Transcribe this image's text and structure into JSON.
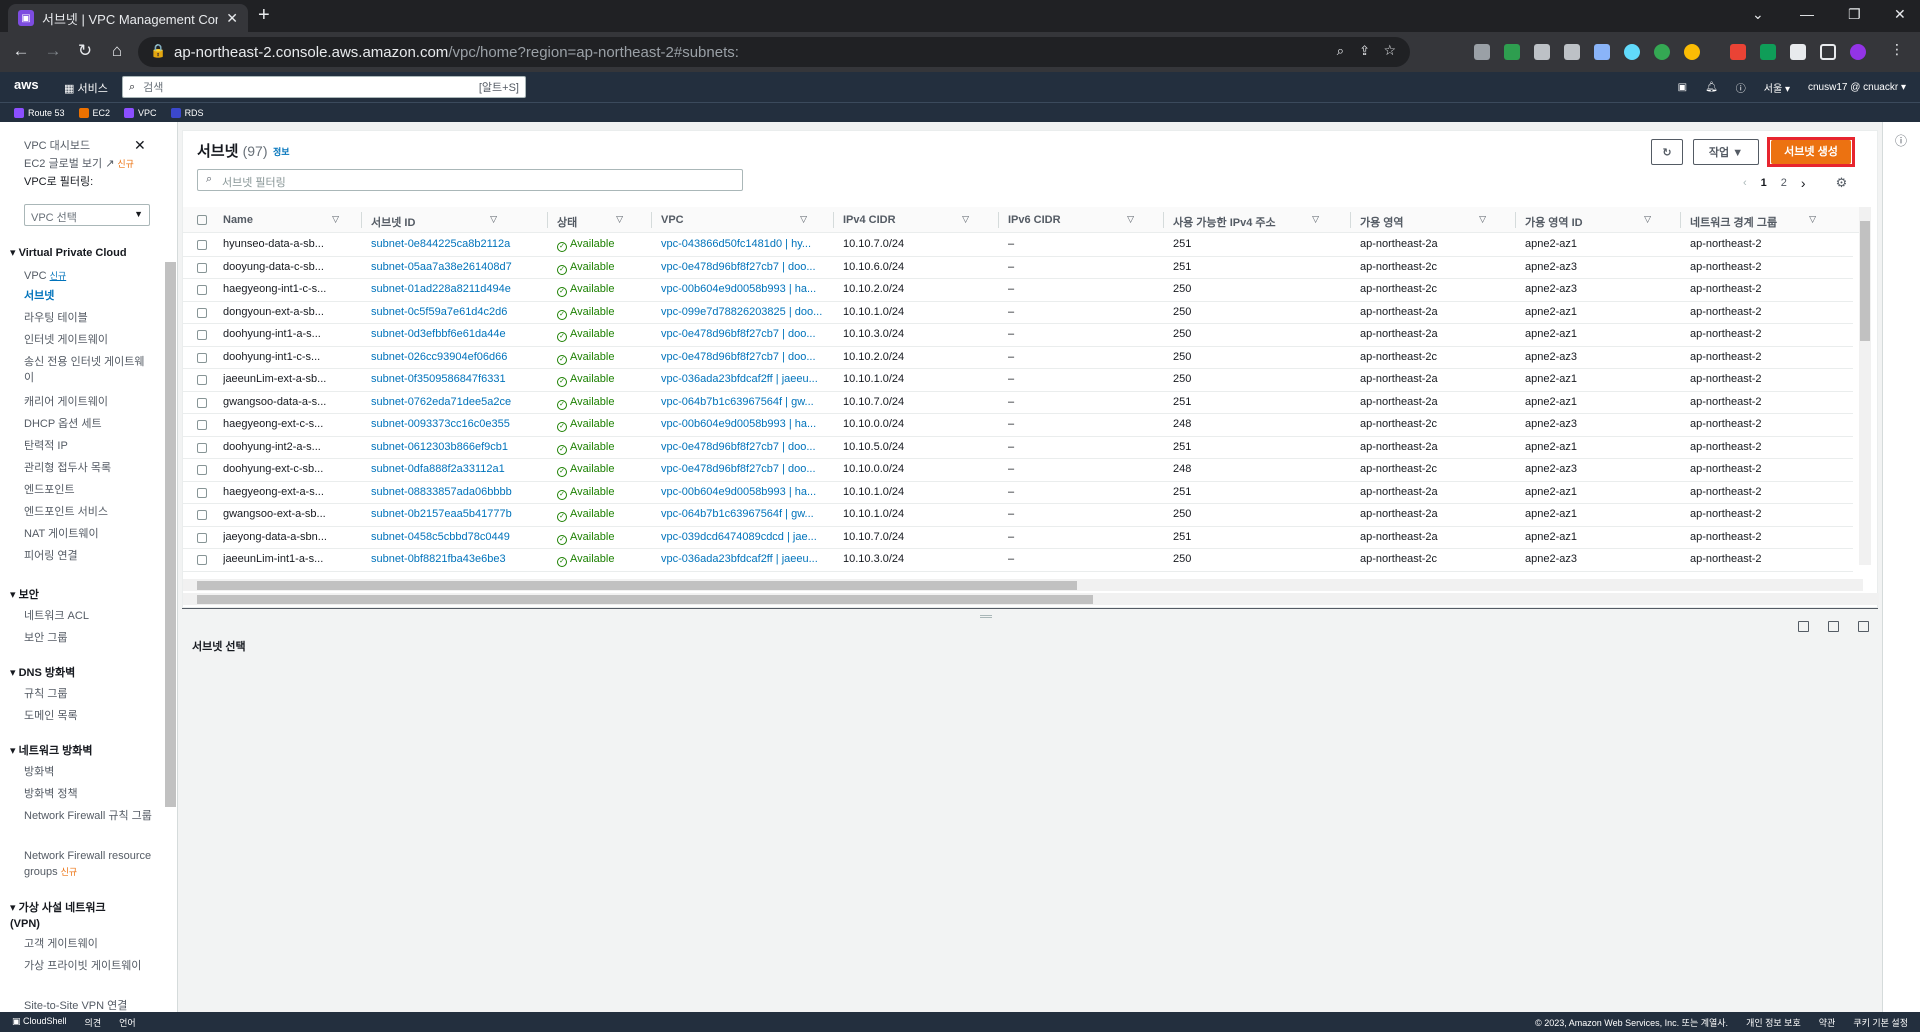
{
  "browser": {
    "tab_title": "서브넷 | VPC Management Con",
    "url_host": "ap-northeast-2.console.aws.amazon.com",
    "url_path": "/vpc/home?region=ap-northeast-2#subnets:"
  },
  "aws_header": {
    "logo": "aws",
    "services_label": "서비스",
    "search_placeholder": "검색",
    "search_shortcut": "[알트+S]",
    "region": "서울 ▾",
    "account": "cnusw17 @ cnuackr ▾"
  },
  "favorites": [
    "Route 53",
    "EC2",
    "VPC",
    "RDS"
  ],
  "sidebar": {
    "dashboard": "VPC 대시보드",
    "global_view": "EC2 글로벌 보기",
    "new_badge": "신규",
    "filter_label": "VPC로 필터링:",
    "filter_select": "VPC 선택",
    "section_vpc": "Virtual Private Cloud",
    "vpc_items": [
      "VPC",
      "서브넷",
      "라우팅 테이블",
      "인터넷 게이트웨이",
      "송신 전용 인터넷 게이트웨이",
      "캐리어 게이트웨이",
      "DHCP 옵션 세트",
      "탄력적 IP",
      "관리형 접두사 목록",
      "엔드포인트",
      "엔드포인트 서비스",
      "NAT 게이트웨이",
      "피어링 연결"
    ],
    "section_security": "보안",
    "security_items": [
      "네트워크 ACL",
      "보안 그룹"
    ],
    "section_dns": "DNS 방화벽",
    "dns_items": [
      "규칙 그룹",
      "도메인 목록"
    ],
    "section_nfw": "네트워크 방화벽",
    "nfw_items": [
      "방화벽",
      "방화벽 정책",
      "Network Firewall 규칙 그룹",
      "Network Firewall resource groups"
    ],
    "section_vpn": "가상 사설 네트워크 (VPN)",
    "vpn_items": [
      "고객 게이트웨이",
      "가상 프라이빗 게이트웨이",
      "Site-to-Site VPN 연결"
    ]
  },
  "panel": {
    "title": "서브넷",
    "count": "(97)",
    "info": "정보",
    "filter_placeholder": "서브넷 필터링",
    "actions_label": "작업 ▼",
    "create_label": "서브넷 생성",
    "pages": [
      "1",
      "2"
    ],
    "detail_label": "서브넷 선택"
  },
  "table": {
    "columns": [
      "Name",
      "서브넷 ID",
      "상태",
      "VPC",
      "IPv4 CIDR",
      "IPv6 CIDR",
      "사용 가능한 IPv4 주소",
      "가용 영역",
      "가용 영역 ID",
      "네트워크 경계 그룹"
    ],
    "rows": [
      [
        "hyunseo-data-a-sb...",
        "subnet-0e844225ca8b2112a",
        "Available",
        "vpc-043866d50fc1481d0 | hy...",
        "10.10.7.0/24",
        "–",
        "251",
        "ap-northeast-2a",
        "apne2-az1",
        "ap-northeast-2"
      ],
      [
        "dooyung-data-c-sb...",
        "subnet-05aa7a38e261408d7",
        "Available",
        "vpc-0e478d96bf8f27cb7 | doo...",
        "10.10.6.0/24",
        "–",
        "251",
        "ap-northeast-2c",
        "apne2-az3",
        "ap-northeast-2"
      ],
      [
        "haegyeong-int1-c-s...",
        "subnet-01ad228a8211d494e",
        "Available",
        "vpc-00b604e9d0058b993 | ha...",
        "10.10.2.0/24",
        "–",
        "250",
        "ap-northeast-2c",
        "apne2-az3",
        "ap-northeast-2"
      ],
      [
        "dongyoun-ext-a-sb...",
        "subnet-0c5f59a7e61d4c2d6",
        "Available",
        "vpc-099e7d78826203825 | doo...",
        "10.10.1.0/24",
        "–",
        "250",
        "ap-northeast-2a",
        "apne2-az1",
        "ap-northeast-2"
      ],
      [
        "doohyung-int1-a-s...",
        "subnet-0d3efbbf6e61da44e",
        "Available",
        "vpc-0e478d96bf8f27cb7 | doo...",
        "10.10.3.0/24",
        "–",
        "250",
        "ap-northeast-2a",
        "apne2-az1",
        "ap-northeast-2"
      ],
      [
        "doohyung-int1-c-s...",
        "subnet-026cc93904ef06d66",
        "Available",
        "vpc-0e478d96bf8f27cb7 | doo...",
        "10.10.2.0/24",
        "–",
        "250",
        "ap-northeast-2c",
        "apne2-az3",
        "ap-northeast-2"
      ],
      [
        "jaeeunLim-ext-a-sb...",
        "subnet-0f3509586847f6331",
        "Available",
        "vpc-036ada23bfdcaf2ff | jaeeu...",
        "10.10.1.0/24",
        "–",
        "250",
        "ap-northeast-2a",
        "apne2-az1",
        "ap-northeast-2"
      ],
      [
        "gwangsoo-data-a-s...",
        "subnet-0762eda71dee5a2ce",
        "Available",
        "vpc-064b7b1c63967564f | gw...",
        "10.10.7.0/24",
        "–",
        "251",
        "ap-northeast-2a",
        "apne2-az1",
        "ap-northeast-2"
      ],
      [
        "haegyeong-ext-c-s...",
        "subnet-0093373cc16c0e355",
        "Available",
        "vpc-00b604e9d0058b993 | ha...",
        "10.10.0.0/24",
        "–",
        "248",
        "ap-northeast-2c",
        "apne2-az3",
        "ap-northeast-2"
      ],
      [
        "doohyung-int2-a-s...",
        "subnet-0612303b866ef9cb1",
        "Available",
        "vpc-0e478d96bf8f27cb7 | doo...",
        "10.10.5.0/24",
        "–",
        "251",
        "ap-northeast-2a",
        "apne2-az1",
        "ap-northeast-2"
      ],
      [
        "doohyung-ext-c-sb...",
        "subnet-0dfa888f2a33112a1",
        "Available",
        "vpc-0e478d96bf8f27cb7 | doo...",
        "10.10.0.0/24",
        "–",
        "248",
        "ap-northeast-2c",
        "apne2-az3",
        "ap-northeast-2"
      ],
      [
        "haegyeong-ext-a-s...",
        "subnet-08833857ada06bbbb",
        "Available",
        "vpc-00b604e9d0058b993 | ha...",
        "10.10.1.0/24",
        "–",
        "251",
        "ap-northeast-2a",
        "apne2-az1",
        "ap-northeast-2"
      ],
      [
        "gwangsoo-ext-a-sb...",
        "subnet-0b2157eaa5b41777b",
        "Available",
        "vpc-064b7b1c63967564f | gw...",
        "10.10.1.0/24",
        "–",
        "250",
        "ap-northeast-2a",
        "apne2-az1",
        "ap-northeast-2"
      ],
      [
        "jaeyong-data-a-sbn...",
        "subnet-0458c5cbbd78c0449",
        "Available",
        "vpc-039dcd6474089cdcd | jae...",
        "10.10.7.0/24",
        "–",
        "251",
        "ap-northeast-2a",
        "apne2-az1",
        "ap-northeast-2"
      ],
      [
        "jaeeunLim-int1-a-s...",
        "subnet-0bf8821fba43e6be3",
        "Available",
        "vpc-036ada23bfdcaf2ff | jaeeu...",
        "10.10.3.0/24",
        "–",
        "250",
        "ap-northeast-2c",
        "apne2-az3",
        "ap-northeast-2"
      ]
    ]
  },
  "footer": {
    "cloudshell": "CloudShell",
    "feedback": "의견",
    "language": "언어",
    "copyright": "© 2023, Amazon Web Services, Inc. 또는 계열사.",
    "privacy": "개인 정보 보호",
    "terms": "약관",
    "cookies": "쿠키 기본 설정"
  },
  "colors": {
    "accent": "#ec7211",
    "link": "#0073bb",
    "success": "#1d8102",
    "highlight": "#e7252f",
    "header": "#232f3e"
  }
}
